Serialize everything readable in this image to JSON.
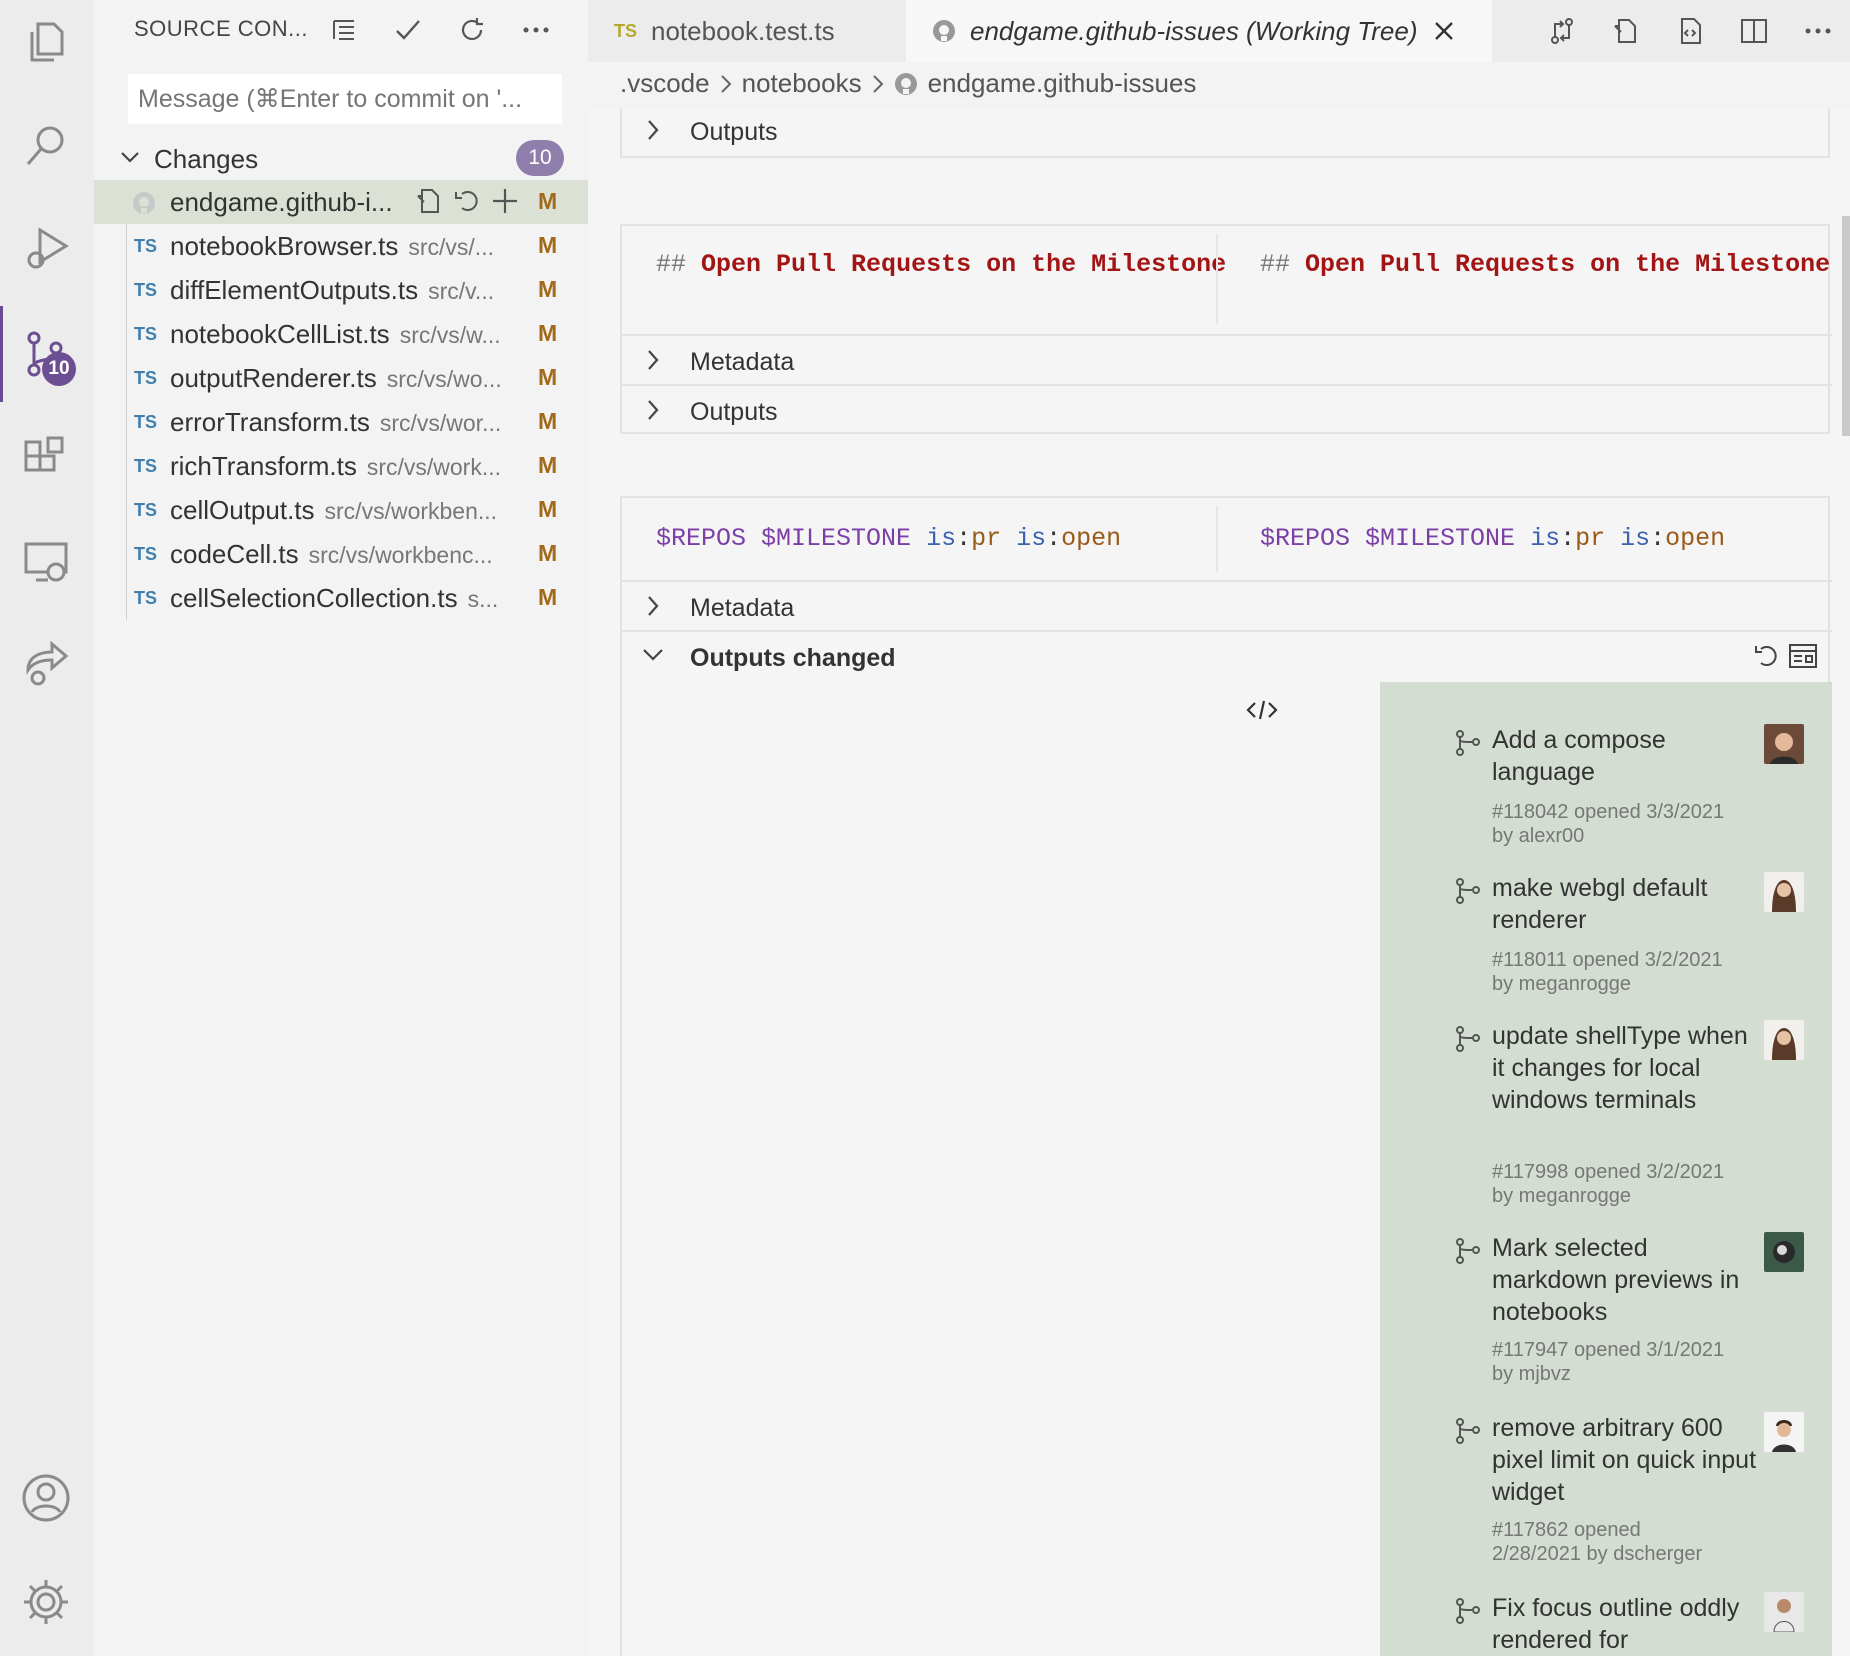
{
  "activity_bar": {
    "icons": [
      "explorer-icon",
      "search-icon",
      "run-debug-icon",
      "source-control-icon",
      "extensions-icon",
      "remote-explorer-icon",
      "live-share-icon",
      "accounts-icon",
      "settings-gear-icon"
    ],
    "scm_badge": "10"
  },
  "sidebar": {
    "title": "SOURCE CON...",
    "commit_placeholder": "Message (⌘Enter to commit on '...",
    "changes_label": "Changes",
    "changes_count": "10",
    "files": [
      {
        "icon": "github",
        "name": "endgame.github-i...",
        "path": "",
        "status": "M"
      },
      {
        "icon": "TS",
        "name": "notebookBrowser.ts",
        "path": "src/vs/...",
        "status": "M"
      },
      {
        "icon": "TS",
        "name": "diffElementOutputs.ts",
        "path": "src/v...",
        "status": "M"
      },
      {
        "icon": "TS",
        "name": "notebookCellList.ts",
        "path": "src/vs/w...",
        "status": "M"
      },
      {
        "icon": "TS",
        "name": "outputRenderer.ts",
        "path": "src/vs/wo...",
        "status": "M"
      },
      {
        "icon": "TS",
        "name": "errorTransform.ts",
        "path": "src/vs/wor...",
        "status": "M"
      },
      {
        "icon": "TS",
        "name": "richTransform.ts",
        "path": "src/vs/work...",
        "status": "M"
      },
      {
        "icon": "TS",
        "name": "cellOutput.ts",
        "path": "src/vs/workben...",
        "status": "M"
      },
      {
        "icon": "TS",
        "name": "codeCell.ts",
        "path": "src/vs/workbenc...",
        "status": "M"
      },
      {
        "icon": "TS",
        "name": "cellSelectionCollection.ts",
        "path": "s...",
        "status": "M"
      }
    ]
  },
  "tabs": [
    {
      "badge": "TS",
      "label": "notebook.test.ts"
    },
    {
      "label": "endgame.github-issues (Working Tree)"
    }
  ],
  "breadcrumb": [
    ".vscode",
    "notebooks",
    "endgame.github-issues"
  ],
  "cells": {
    "outputs_label": "Outputs",
    "metadata_label": "Metadata",
    "outputs_changed_label": "Outputs changed",
    "markdown_hash": "##",
    "markdown_heading": "Open Pull Requests on the Milestone",
    "query": {
      "repos": "$REPOS",
      "milestone": "$MILESTONE",
      "is1": "is",
      "v1": "pr",
      "is2": "is",
      "v2": "open"
    }
  },
  "pull_requests": [
    {
      "title": "Add a compose language",
      "number": "#118042",
      "opened": "opened 3/3/2021",
      "by": "by alexr00"
    },
    {
      "title": "make webgl default renderer",
      "number": "#118011",
      "opened": "opened 3/2/2021",
      "by": "by meganrogge"
    },
    {
      "title": "update shellType when it changes for local windows terminals",
      "number": "#117998",
      "opened": "opened 3/2/2021",
      "by": "by meganrogge"
    },
    {
      "title": "Mark selected markdown previews in notebooks",
      "number": "#117947",
      "opened": "opened 3/1/2021",
      "by": "by mjbvz"
    },
    {
      "title": "remove arbitrary 600 pixel limit on quick input widget",
      "number": "#117862",
      "opened": "opened",
      "by": "2/28/2021 by dscherger"
    },
    {
      "title": "Fix focus outline oddly rendered for",
      "number": "",
      "opened": "",
      "by": ""
    }
  ],
  "colors": {
    "accent": "#6c4e93",
    "output_bg": "#d3ddd1",
    "heading_red": "#a31515"
  }
}
